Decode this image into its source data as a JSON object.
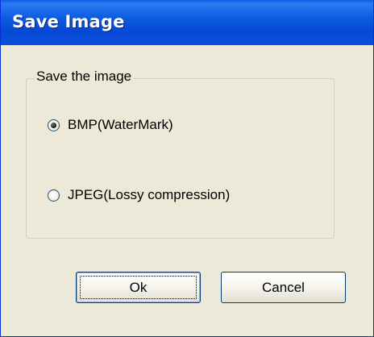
{
  "window": {
    "title": "Save Image"
  },
  "group": {
    "label": "Save the image",
    "options": [
      {
        "label": "BMP(WaterMark)",
        "selected": true
      },
      {
        "label": "JPEG(Lossy compression)",
        "selected": false
      }
    ]
  },
  "buttons": {
    "ok": "Ok",
    "cancel": "Cancel"
  }
}
